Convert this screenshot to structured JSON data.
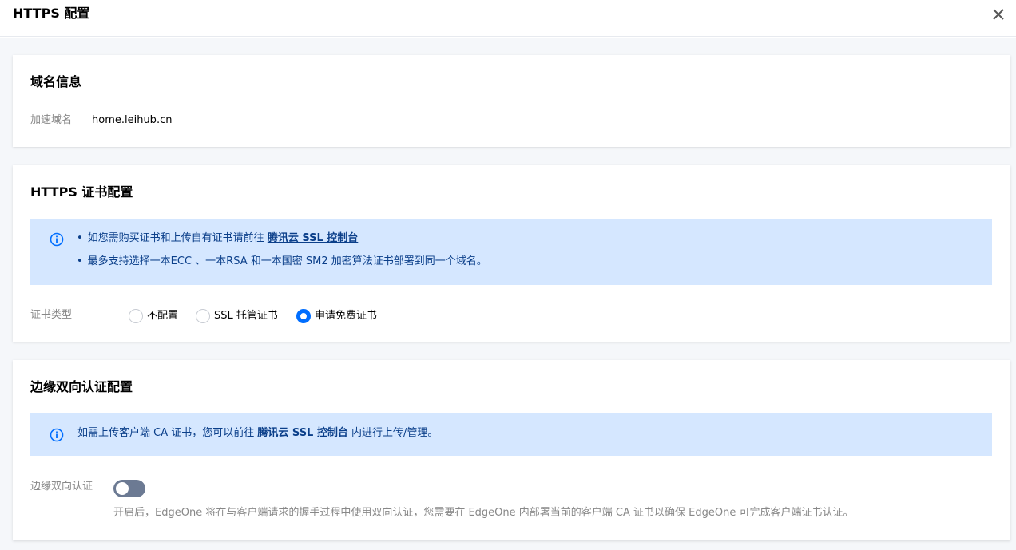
{
  "dialog": {
    "title": "HTTPS 配置"
  },
  "domain_card": {
    "title": "域名信息",
    "label": "加速域名",
    "value": "home.leihub.cn"
  },
  "cert_card": {
    "title": "HTTPS 证书配置",
    "notice": {
      "line1_prefix": "如您需购买证书和上传自有证书请前往",
      "line1_link": "腾讯云 SSL 控制台",
      "line2": "最多支持选择一本ECC 、一本RSA 和一本国密 SM2 加密算法证书部署到同一个域名。"
    },
    "type_label": "证书类型",
    "options": [
      {
        "label": "不配置",
        "checked": false
      },
      {
        "label": "SSL 托管证书",
        "checked": false
      },
      {
        "label": "申请免费证书",
        "checked": true
      }
    ]
  },
  "mtls_card": {
    "title": "边缘双向认证配置",
    "notice": {
      "prefix": "如需上传客户端 CA 证书，您可以前往",
      "link": "腾讯云 SSL 控制台",
      "suffix": "内进行上传/管理。"
    },
    "toggle_label": "边缘双向认证",
    "toggle_on": false,
    "help": "开启后，EdgeOne 将在与客户端请求的握手过程中使用双向认证，您需要在 EdgeOne 内部署当前的客户端 CA 证书以确保 EdgeOne 可完成客户端证书认证。"
  },
  "colors": {
    "accent": "#006eff",
    "notice_bg": "#d5e7ff",
    "notice_text": "#0b3f8a",
    "toggle_off": "#6c7a93"
  }
}
